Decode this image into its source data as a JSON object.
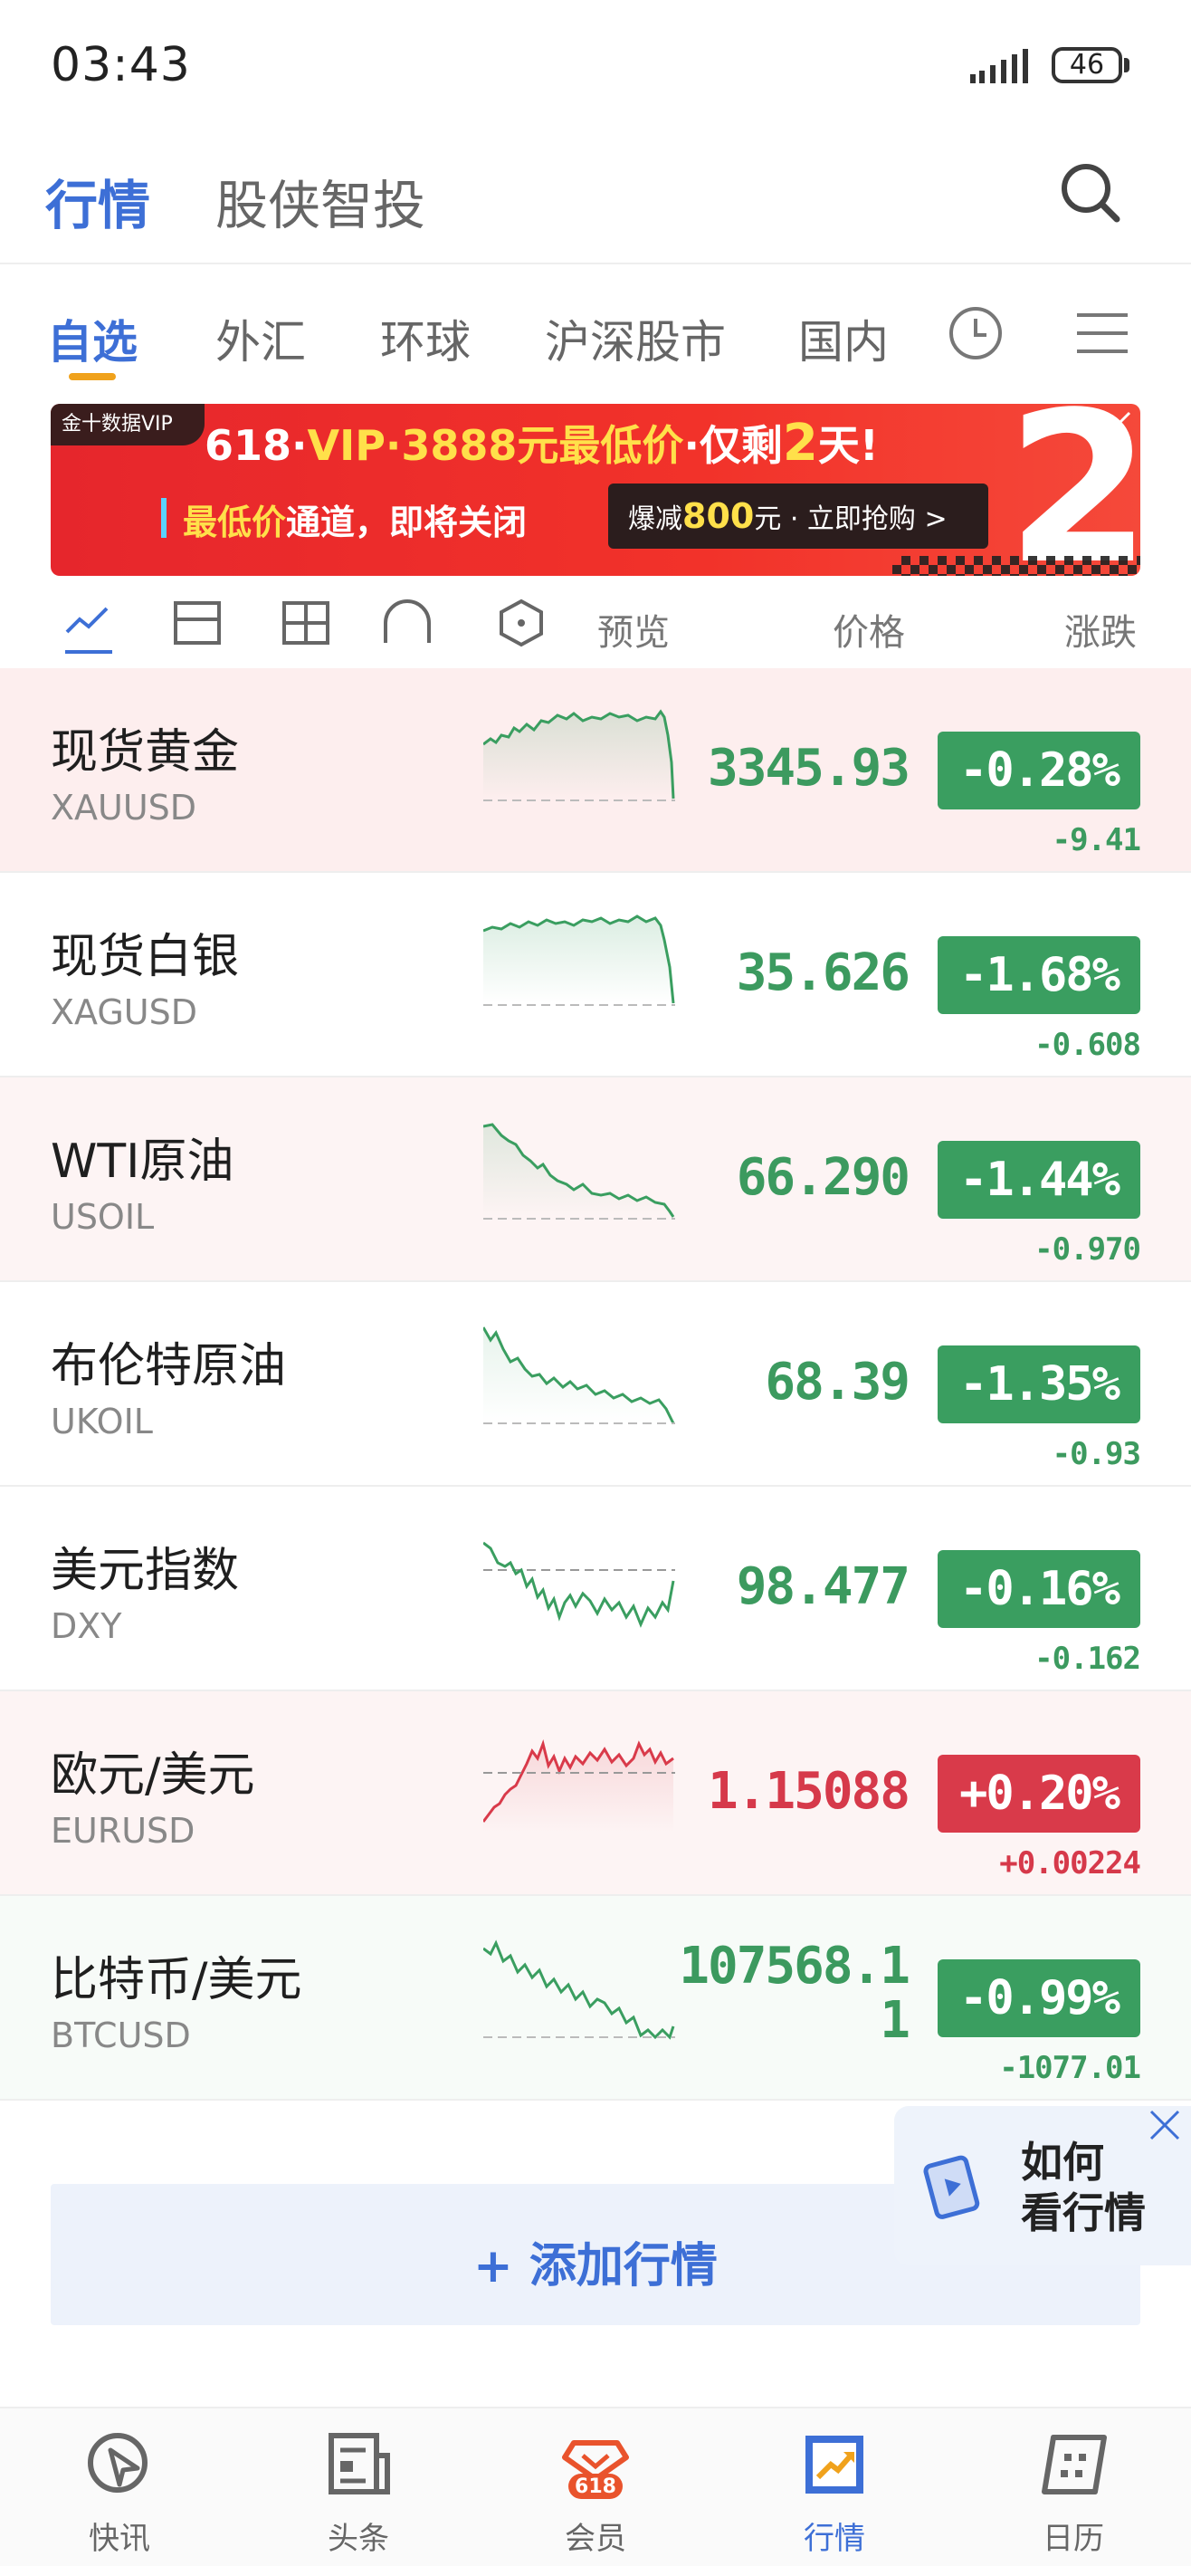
{
  "status_bar": {
    "time": "03:43",
    "battery": "46"
  },
  "header": {
    "tab_active": "行情",
    "tab_inactive": "股侠智投"
  },
  "subtabs": [
    "自选",
    "外汇",
    "环球",
    "沪深股市",
    "国内"
  ],
  "banner": {
    "brand": "金十数据VIP",
    "line1_a": "618·",
    "line1_b": "VIP·3888元最低价",
    "line1_c": "·仅剩",
    "line1_d": "2",
    "line1_e": "天!",
    "line2_a": "最低价",
    "line2_b": "通道，即将关闭",
    "cta_a": "爆减",
    "cta_b": "800",
    "cta_c": "元 · 立即抢购 >",
    "big": "2"
  },
  "view_bar": {
    "preview": "预览",
    "price": "价格",
    "change": "涨跌"
  },
  "quotes": [
    {
      "name": "现货黄金",
      "code": "XAUUSD",
      "price": "3345.93",
      "pct": "-0.28%",
      "chg": "-9.41",
      "dir": "down"
    },
    {
      "name": "现货白银",
      "code": "XAGUSD",
      "price": "35.626",
      "pct": "-1.68%",
      "chg": "-0.608",
      "dir": "down"
    },
    {
      "name": "WTI原油",
      "code": "USOIL",
      "price": "66.290",
      "pct": "-1.44%",
      "chg": "-0.970",
      "dir": "down"
    },
    {
      "name": "布伦特原油",
      "code": "UKOIL",
      "price": "68.39",
      "pct": "-1.35%",
      "chg": "-0.93",
      "dir": "down"
    },
    {
      "name": "美元指数",
      "code": "DXY",
      "price": "98.477",
      "pct": "-0.16%",
      "chg": "-0.162",
      "dir": "down"
    },
    {
      "name": "欧元/美元",
      "code": "EURUSD",
      "price": "1.15088",
      "pct": "+0.20%",
      "chg": "+0.00224",
      "dir": "up"
    },
    {
      "name": "比特币/美元",
      "code": "BTCUSD",
      "price": "107568.1",
      "price_wrap": "1",
      "pct": "-0.99%",
      "chg": "-1077.01",
      "dir": "down"
    }
  ],
  "howto": {
    "line1": "如何",
    "line2": "看行情"
  },
  "add_button": "+ 添加行情",
  "bottom_nav": [
    {
      "label": "快讯",
      "icon": "flash-news-icon"
    },
    {
      "label": "头条",
      "icon": "newspaper-icon"
    },
    {
      "label": "会员",
      "icon": "member-icon",
      "badge": "618"
    },
    {
      "label": "行情",
      "icon": "market-chart-icon",
      "active": true
    },
    {
      "label": "日历",
      "icon": "calendar-icon"
    }
  ],
  "colors": {
    "accent": "#3d6fd6",
    "down": "#3a9e60",
    "up": "#d93a4a",
    "highlight_row": "#fdeeee"
  }
}
